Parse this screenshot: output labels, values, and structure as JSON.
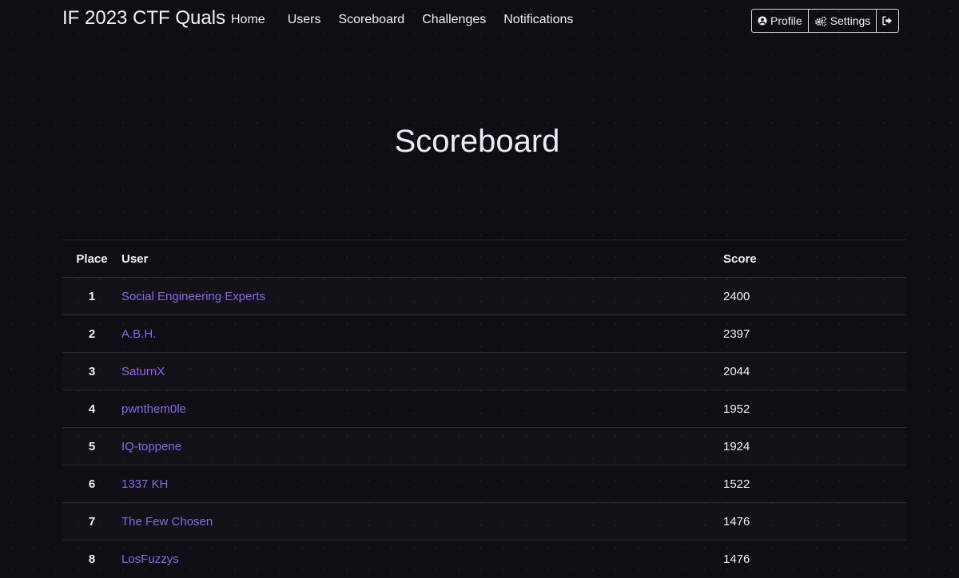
{
  "navbar": {
    "brand": "IF 2023 CTF Quals",
    "links": [
      "Home",
      "Users",
      "Scoreboard",
      "Challenges",
      "Notifications"
    ],
    "profile_label": "Profile",
    "settings_label": "Settings",
    "profile_icon": "user-circle-icon",
    "settings_icon": "gears-icon",
    "logout_icon": "sign-out-icon"
  },
  "page": {
    "title": "Scoreboard"
  },
  "table": {
    "headers": [
      "Place",
      "User",
      "Score"
    ],
    "rows": [
      {
        "place": "1",
        "user": "Social Engineering Experts",
        "score": "2400"
      },
      {
        "place": "2",
        "user": "A.B.H.",
        "score": "2397"
      },
      {
        "place": "3",
        "user": "SaturnX",
        "score": "2044"
      },
      {
        "place": "4",
        "user": "pwnthem0le",
        "score": "1952"
      },
      {
        "place": "5",
        "user": "IQ-toppene",
        "score": "1924"
      },
      {
        "place": "6",
        "user": "1337 KH",
        "score": "1522"
      },
      {
        "place": "7",
        "user": "The Few Chosen",
        "score": "1476"
      },
      {
        "place": "8",
        "user": "LosFuzzys",
        "score": "1476"
      }
    ]
  },
  "colors": {
    "background": "#0f0e15",
    "accent_link": "#8a66e6",
    "title": "#ecebf7"
  }
}
